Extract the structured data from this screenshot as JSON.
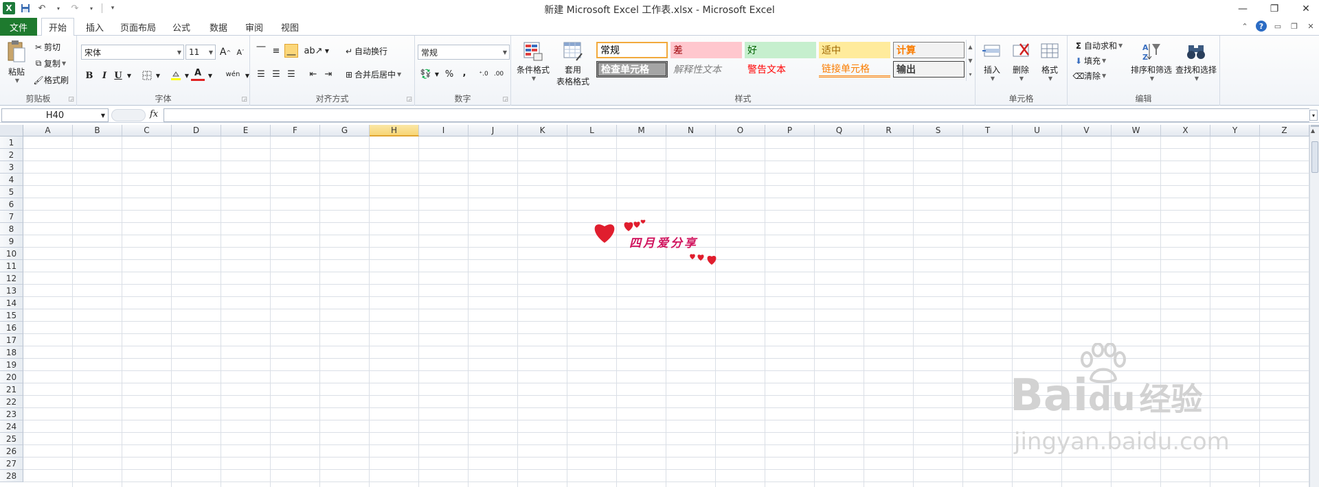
{
  "window": {
    "title": "新建 Microsoft Excel 工作表.xlsx  -  Microsoft Excel",
    "qat": {
      "logo": "X",
      "save_icon": "save-icon",
      "undo_icon": "undo-icon",
      "redo_icon": "redo-icon"
    }
  },
  "tabs": {
    "file": "文件",
    "items": [
      "开始",
      "插入",
      "页面布局",
      "公式",
      "数据",
      "审阅",
      "视图"
    ],
    "active": "开始"
  },
  "ribbon": {
    "clipboard": {
      "label": "剪贴板",
      "paste": "粘贴",
      "cut": "剪切",
      "copy": "复制",
      "painter": "格式刷"
    },
    "font": {
      "label": "字体",
      "name": "宋体",
      "size": "11",
      "bold": "B",
      "italic": "I",
      "underline": "U",
      "font_color": "A",
      "wen": "wén"
    },
    "alignment": {
      "label": "对齐方式",
      "wrap": "自动换行",
      "merge": "合并后居中"
    },
    "number": {
      "label": "数字",
      "format": "常规",
      "percent": "%",
      "comma": ","
    },
    "styles": {
      "label": "样式",
      "cond_format": "条件格式",
      "table_format_1": "套用",
      "table_format_2": "表格格式",
      "cells": [
        {
          "text": "常规",
          "bg": "#ffffff",
          "fg": "#000000",
          "border": "#f2a93b"
        },
        {
          "text": "差",
          "bg": "#ffc7ce",
          "fg": "#9c0006",
          "border": "none"
        },
        {
          "text": "好",
          "bg": "#c6efce",
          "fg": "#006100",
          "border": "none"
        },
        {
          "text": "适中",
          "bg": "#ffeb9c",
          "fg": "#9c6500",
          "border": "none"
        },
        {
          "text": "计算",
          "bg": "#f2f2f2",
          "fg": "#fa7d00",
          "border": "#7f7f7f"
        },
        {
          "text": "检查单元格",
          "bg": "#a5a5a5",
          "fg": "#ffffff",
          "border": "#3f3f3f"
        },
        {
          "text": "解释性文本",
          "bg": "transparent",
          "fg": "#7f7f7f",
          "border": "none"
        },
        {
          "text": "警告文本",
          "bg": "transparent",
          "fg": "#ff0000",
          "border": "none"
        },
        {
          "text": "链接单元格",
          "bg": "transparent",
          "fg": "#fa7d00",
          "border": "bottom"
        },
        {
          "text": "输出",
          "bg": "#f2f2f2",
          "fg": "#3f3f3f",
          "border": "#3f3f3f"
        }
      ]
    },
    "cells": {
      "label": "单元格",
      "insert": "插入",
      "delete": "删除",
      "format": "格式"
    },
    "editing": {
      "label": "编辑",
      "autosum": "自动求和",
      "fill": "填充",
      "clear": "清除",
      "sort": "排序和筛选",
      "find": "查找和选择"
    }
  },
  "formula_bar": {
    "name_box": "H40",
    "fx": "fx",
    "value": ""
  },
  "grid": {
    "columns": [
      "A",
      "B",
      "C",
      "D",
      "E",
      "F",
      "G",
      "H",
      "I",
      "J",
      "K",
      "L",
      "M",
      "N",
      "O",
      "P",
      "Q",
      "R",
      "S",
      "T",
      "U",
      "V",
      "W",
      "X",
      "Y",
      "Z"
    ],
    "rows": [
      "1",
      "2",
      "3",
      "4",
      "5",
      "6",
      "7",
      "8",
      "9",
      "10",
      "11",
      "12",
      "13",
      "14",
      "15",
      "16",
      "17",
      "18",
      "19",
      "20",
      "21",
      "22",
      "23",
      "24",
      "25",
      "26",
      "27",
      "28"
    ],
    "selected_column": "H"
  },
  "picture": {
    "text": "四月爱分享",
    "heart_color": "#e01e2e",
    "text_color": "#d0145e"
  },
  "watermark": {
    "brand": "Bai",
    "brand2": "du",
    "brand_cn": "经验",
    "url": "jingyan.baidu.com"
  }
}
